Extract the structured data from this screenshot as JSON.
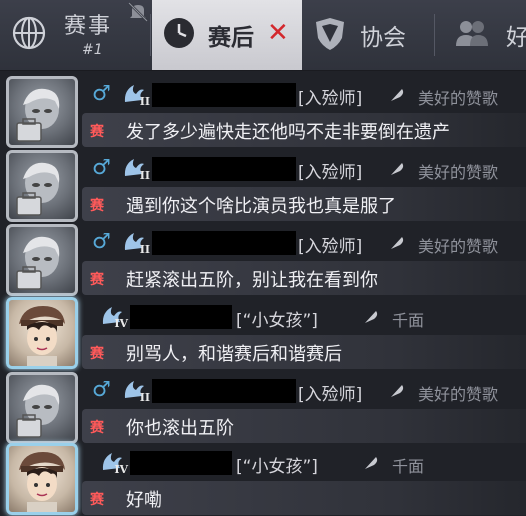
{
  "tabs": {
    "match": {
      "label": "赛事",
      "sub": "#1",
      "icon": "globe-icon",
      "muted_icon": "muted-bell-icon"
    },
    "post": {
      "label": "赛后",
      "icon": "clock-icon",
      "close": "✕"
    },
    "assoc": {
      "label": "协会",
      "icon": "shield-icon"
    },
    "friend": {
      "label": "好",
      "icon": "people-icon"
    }
  },
  "messages": [
    {
      "avatar": "mad-doctor-avatar",
      "gender": "♂",
      "rank": "II",
      "title": "[入殓师]",
      "sign": "美好的赞歌",
      "channel": "赛",
      "text": "发了多少遍快走还他吗不走非要倒在遗产"
    },
    {
      "avatar": "mad-doctor-avatar",
      "gender": "♂",
      "rank": "II",
      "title": "[入殓师]",
      "sign": "美好的赞歌",
      "channel": "赛",
      "text": "遇到你这个啥比演员我也真是服了"
    },
    {
      "avatar": "mad-doctor-avatar",
      "gender": "♂",
      "rank": "II",
      "title": "[入殓师]",
      "sign": "美好的赞歌",
      "channel": "赛",
      "text": "赶紧滚出五阶，别让我在看到你"
    },
    {
      "avatar": "boy-avatar",
      "gender": "",
      "rank": "IV",
      "title": "[“小女孩”]",
      "sign": "千面",
      "channel": "赛",
      "text": "别骂人，和谐赛后和谐赛后"
    },
    {
      "avatar": "mad-doctor-avatar",
      "gender": "♂",
      "rank": "II",
      "title": "[入殓师]",
      "sign": "美好的赞歌",
      "channel": "赛",
      "text": "你也滚出五阶"
    },
    {
      "avatar": "boy-avatar",
      "gender": "",
      "rank": "IV",
      "title": "[“小女孩”]",
      "sign": "千面",
      "channel": "赛",
      "text": "好嘞"
    }
  ],
  "colors": {
    "accent_red": "#d3282d",
    "gender_blue": "#57a9d8",
    "channel_red": "#ff5a5a"
  }
}
